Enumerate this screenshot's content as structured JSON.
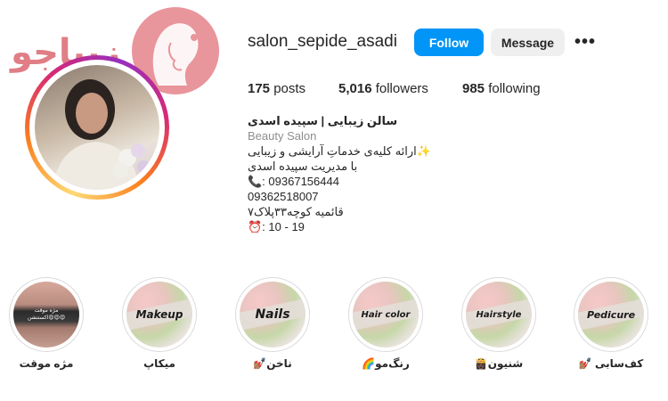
{
  "profile": {
    "username": "salon_sepide_asadi",
    "follow_label": "Follow",
    "message_label": "Message",
    "more_label": "•••"
  },
  "logo": {
    "text": "زیباجو"
  },
  "stats": {
    "posts_count": "175",
    "posts_label": "posts",
    "followers_count": "5,016",
    "followers_label": "followers",
    "following_count": "985",
    "following_label": "following"
  },
  "bio": {
    "name": "سالن زیبایی | سپیده اسدی",
    "category": "Beauty Salon",
    "lines": [
      "✨ارائه کلیه‌ی خدماتِ آرایشی و زیبایی",
      "با مدیریت سپیده اسدی",
      "09367156444 :📞",
      "09362518007",
      "قائمیه کوچه۳۳پلاک۷",
      "19 - 10 :⏰"
    ]
  },
  "highlights": [
    {
      "cover_text": "مژه موقت\nاکستنشن😍😍😍",
      "label": "مژه موقت"
    },
    {
      "cover_text": "Makeup",
      "label": "میکاپ"
    },
    {
      "cover_text": "Nails",
      "label": "ناخن💅🏽"
    },
    {
      "cover_text": "Hair color",
      "label": "رنگ‌مو🌈"
    },
    {
      "cover_text": "Hairstyle",
      "label": "شنیون👸🏿"
    },
    {
      "cover_text": "Pedicure",
      "label": "کف‌سابی 💅🏽"
    }
  ],
  "colors": {
    "follow_button": "#0095f6",
    "message_button": "#efefef",
    "logo_pink": "#e07e86"
  }
}
